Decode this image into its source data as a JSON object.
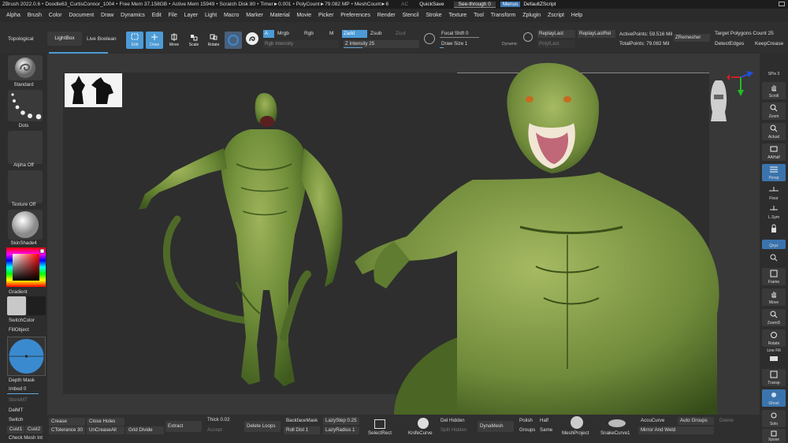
{
  "titlebar": {
    "app": "ZBrush 2022.0.6",
    "doc": "Doodle63_CurtisConnor_1004",
    "free_mem": "Free Mem 37.158GB",
    "active_mem": "Active Mem 15949",
    "scratch": "Scratch Disk 80",
    "timer": "Timer►0.001",
    "polycount": "PolyCount►79.082 MP",
    "meshcount": "MeshCount►6",
    "ac": "AC",
    "quicksave": "QuickSave",
    "seethrough": "See-through  0",
    "menus": "Menus",
    "defaultscript": "DefaultZScript"
  },
  "menubar": [
    "Alpha",
    "Brush",
    "Color",
    "Document",
    "Draw",
    "Dynamics",
    "Edit",
    "File",
    "Layer",
    "Light",
    "Macro",
    "Marker",
    "Material",
    "Movie",
    "Picker",
    "Preferences",
    "Render",
    "Stencil",
    "Stroke",
    "Texture",
    "Tool",
    "Transform",
    "Zplugin",
    "Zscript",
    "Help"
  ],
  "toolshelf": {
    "topological": "Topological",
    "lightbox": "LightBox",
    "live_boolean": "Live Boolean",
    "edit": "Edit",
    "draw": "Draw",
    "move": "Move",
    "scale": "Scale",
    "rotate": "Rotate",
    "a": "A",
    "mrgb": "Mrgb",
    "rgb": "Rgb",
    "m": "M",
    "zadd": "Zadd",
    "zsub": "Zsub",
    "zcut": "Zcut",
    "rgb_intensity": "Rgb Intensity",
    "z_intensity": "Z Intensity 25",
    "focal_shift": "Focal Shift 0",
    "draw_size": "Draw Size 1",
    "dynamic": "Dynamic",
    "replaylast": "ReplayLast",
    "replaylastrel": "ReplayLastRel",
    "polyf_last": "PolyfLast",
    "active_points": "ActivePoints: 59.516 Mil",
    "total_points": "TotalPoints: 79.082 Mil",
    "zremesher": "ZRemesher",
    "target_polygons": "Target Polygons Count 25",
    "detect_edges": "DetectEdges",
    "keep_creases": "KeepCrease"
  },
  "leftshelf": {
    "brush": "Standard",
    "stroke": "Dots",
    "alpha": "Alpha Off",
    "texture": "Texture Off",
    "material": "SkinShade4",
    "gradient": "Gradient",
    "switch_color": "SwitchColor",
    "fill_object": "FillObject",
    "depth_mask": "Depth Mask",
    "imbed": "Imbed 0",
    "store_mt": "StoreMT",
    "del_mt": "DelMT",
    "switch": "Switch",
    "cust1": "Cust1",
    "cust2": "Cust2",
    "check_mesh": "Check Mesh Int"
  },
  "rightshelf": [
    "SPix 3",
    "Scroll",
    "Zoom",
    "Actual",
    "AAHalf",
    "Persp",
    "Floor",
    "L.Sym",
    "",
    "Qxyz",
    "",
    "Frame",
    "Move",
    "ZoomD",
    "Rotate",
    "Line Fill",
    "Transp",
    "Ghost",
    "Solo",
    "Xpose"
  ],
  "bottomshelf": {
    "crease": "Crease",
    "ctolerance": "CTolerance 30",
    "close_holes": "Close Holes",
    "uncrease_all": "UnCreaseAll",
    "grid_divide": "Grid Divide",
    "extract": "Extract",
    "thick": "Thick 0.02",
    "accept": "Accept",
    "delete_loops": "Delete Loops",
    "backface_mask": "BackfaceMask",
    "roll_dist": "Roll Dist 1",
    "lazy_step": "LazyStep 0.25",
    "lazy_radius": "LazyRadius 1",
    "select_rect": "SelectRect",
    "knife_curve": "KnifeCurve",
    "del_hidden": "Del Hidden",
    "split_hidden": "Split Hidden",
    "dynamesh": "DynaMesh",
    "polish": "Polish",
    "groups": "Groups",
    "half": "Half",
    "same": "Same",
    "mesh_project": "MeshProject",
    "snake_curve": "SnakeCurve1",
    "accu_curve": "AccuCurve",
    "auto_groups": "Auto Groups",
    "delete": "Delete",
    "mirror_weld": "Mirror And Weld"
  },
  "colors": {
    "accent": "#4c9bd6",
    "skin_dark": "#3e5a1e",
    "skin_mid": "#6e8c38",
    "skin_light": "#9eb35a",
    "background": "#383838"
  },
  "icons": [
    "edit-icon",
    "draw-icon",
    "move-icon",
    "scale-icon",
    "rotate-icon",
    "gizmo-icon",
    "orientation-head-icon",
    "axis-indicator-icon"
  ]
}
